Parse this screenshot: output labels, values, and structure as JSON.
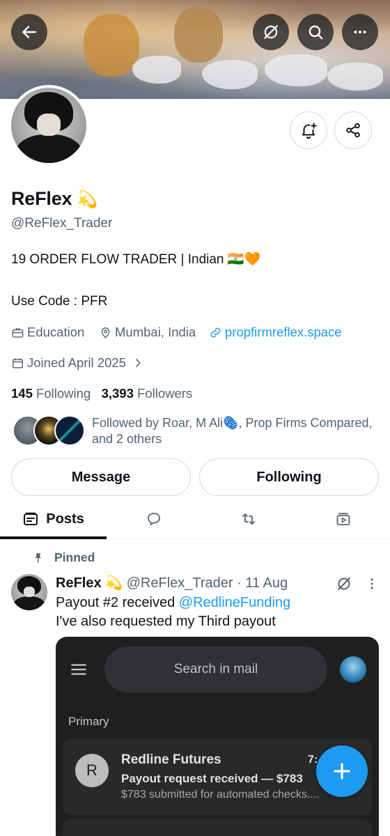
{
  "profile": {
    "name": "ReFlex",
    "name_emoji": "💫",
    "handle": "@ReFlex_Trader",
    "bio_line1": "19 ORDER FLOW TRADER | Indian 🇮🇳🧡",
    "bio_line2": "Use Code : PFR",
    "category": "Education",
    "location": "Mumbai, India",
    "website": "propfirmreflex.space",
    "joined": "Joined April 2025",
    "following_count": "145",
    "following_label": "Following",
    "followers_count": "3,393",
    "followers_label": "Followers",
    "followed_by": "Followed by Roar, M Ali🫆, Prop Firms Compared, and 2 others"
  },
  "buttons": {
    "message": "Message",
    "following": "Following"
  },
  "tabs": {
    "posts": "Posts"
  },
  "post": {
    "pinned_label": "Pinned",
    "author_name": "ReFlex 💫",
    "author_handle": "@ReFlex_Trader",
    "separator": "·",
    "date": "11 Aug",
    "text_line1_prefix": "Payout #2 received ",
    "mention": "@RedlineFunding",
    "text_line2": "I've also requested my Third payout"
  },
  "mail_image": {
    "search_placeholder": "Search in mail",
    "section": "Primary",
    "sender_initial": "R",
    "sender": "Redline Futures",
    "time": "7:",
    "subject": "Payout request received — $783",
    "snippet": "$783 submitted for automated checks...."
  },
  "colors": {
    "accent": "#1d9bf0",
    "text": "#0f1419",
    "secondary": "#536471"
  }
}
